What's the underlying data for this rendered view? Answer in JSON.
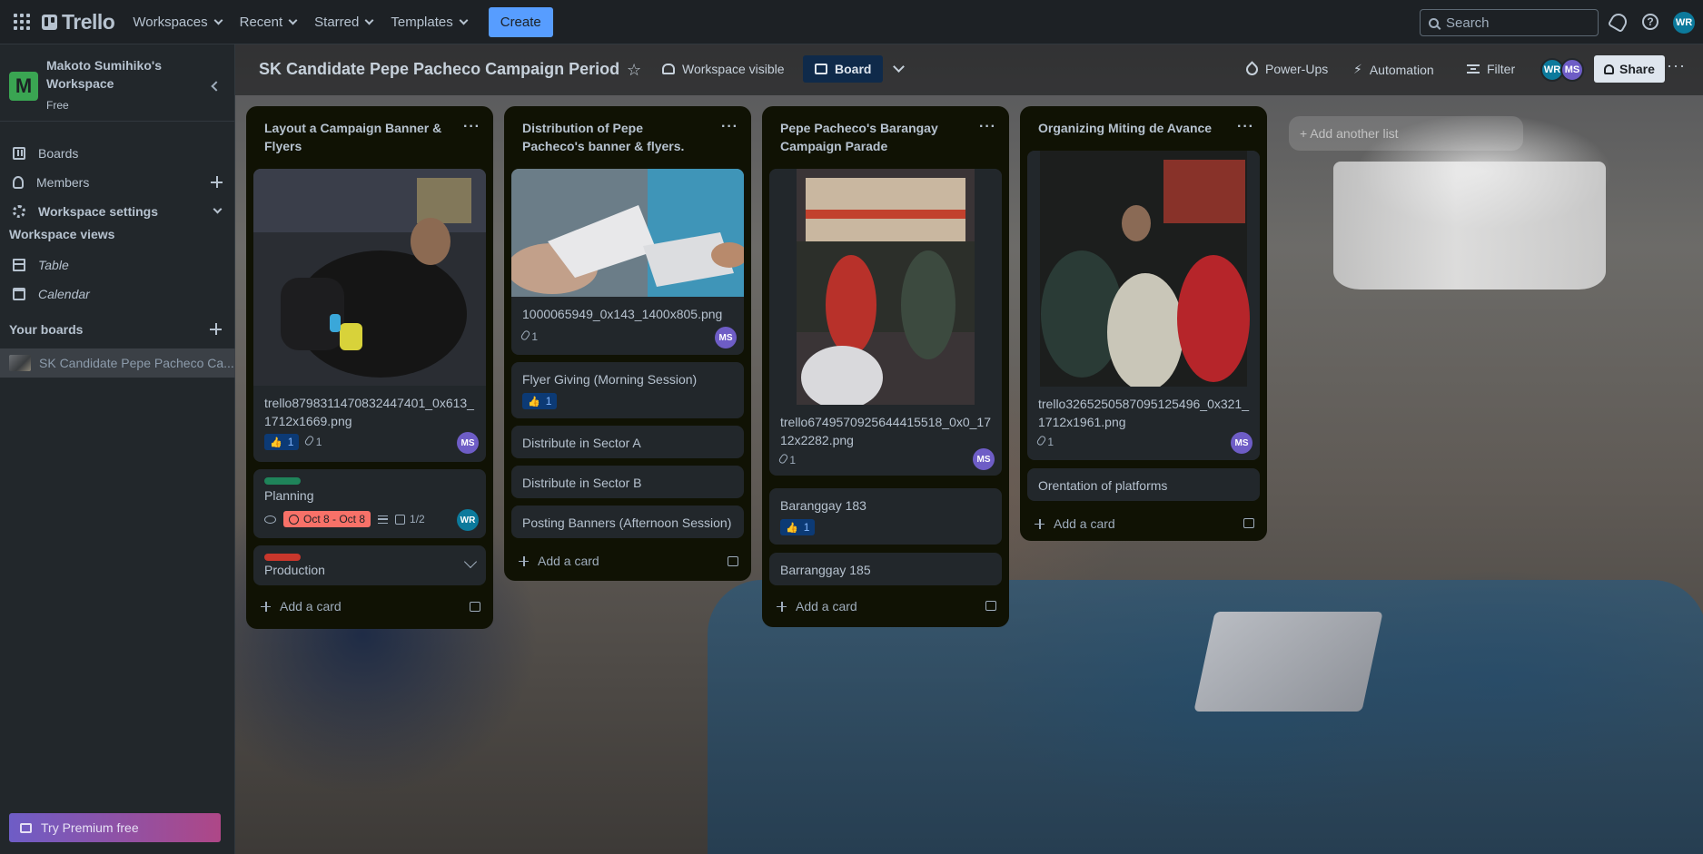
{
  "topbar": {
    "logo": "Trello",
    "nav": [
      "Workspaces",
      "Recent",
      "Starred",
      "Templates"
    ],
    "create_label": "Create",
    "search_placeholder": "Search",
    "user_initials": "WR"
  },
  "sidebar": {
    "workspace_initial": "M",
    "workspace_name": "Makoto Sumihiko's Workspace",
    "workspace_plan": "Free",
    "items": [
      {
        "label": "Boards"
      },
      {
        "label": "Members"
      },
      {
        "label": "Workspace settings"
      }
    ],
    "views_heading": "Workspace views",
    "views": [
      {
        "label": "Table"
      },
      {
        "label": "Calendar"
      }
    ],
    "your_boards_heading": "Your boards",
    "active_board": "SK Candidate Pepe Pacheco Ca...",
    "premium_label": "Try Premium free"
  },
  "board": {
    "title": "SK Candidate Pepe Pacheco Campaign Period",
    "visibility": "Workspace visible",
    "view_label": "Board",
    "powerups_label": "Power-Ups",
    "automation_label": "Automation",
    "filter_label": "Filter",
    "member_initials": [
      "WR",
      "MS"
    ],
    "share_label": "Share",
    "add_list_label": "+ Add another list"
  },
  "lists": [
    {
      "title": "Layout a Campaign Banner & Flyers",
      "cards": [
        {
          "title": "trello8798311470832447401_0x613_1712x1669.png",
          "likes": "1",
          "attachments": "1",
          "member": "MS"
        },
        {
          "title": "Planning",
          "date": "Oct 8 - Oct 8",
          "checklist": "1/2",
          "member": "WR"
        },
        {
          "title": "Production"
        }
      ],
      "add_label": "Add a card"
    },
    {
      "title": "Distribution of Pepe Pacheco's banner & flyers.",
      "cards": [
        {
          "title": "1000065949_0x143_1400x805.png",
          "attachments": "1",
          "member": "MS"
        },
        {
          "title": "Flyer Giving (Morning Session)",
          "likes": "1"
        },
        {
          "title": "Distribute in Sector A"
        },
        {
          "title": "Distribute in Sector B"
        },
        {
          "title": "Posting Banners (Afternoon Session)"
        }
      ],
      "add_label": "Add a card"
    },
    {
      "title": "Pepe Pacheco's Barangay Campaign Parade",
      "cards": [
        {
          "title": "trello6749570925644415518_0x0_1712x2282.png",
          "attachments": "1",
          "member": "MS"
        },
        {
          "title": "Baranggay 183",
          "likes": "1"
        },
        {
          "title": "Barranggay 185"
        }
      ],
      "add_label": "Add a card"
    },
    {
      "title": "Organizing Miting de Avance",
      "cards": [
        {
          "title": "trello3265250587095125496_0x321_1712x1961.png",
          "attachments": "1",
          "member": "MS"
        },
        {
          "title": "Orentation of platforms"
        }
      ],
      "add_label": "Add a card"
    }
  ],
  "colors": {
    "accent": "#579dff",
    "label_green": "#1f845a",
    "label_red": "#c9372c",
    "due_date": "#f87168"
  }
}
